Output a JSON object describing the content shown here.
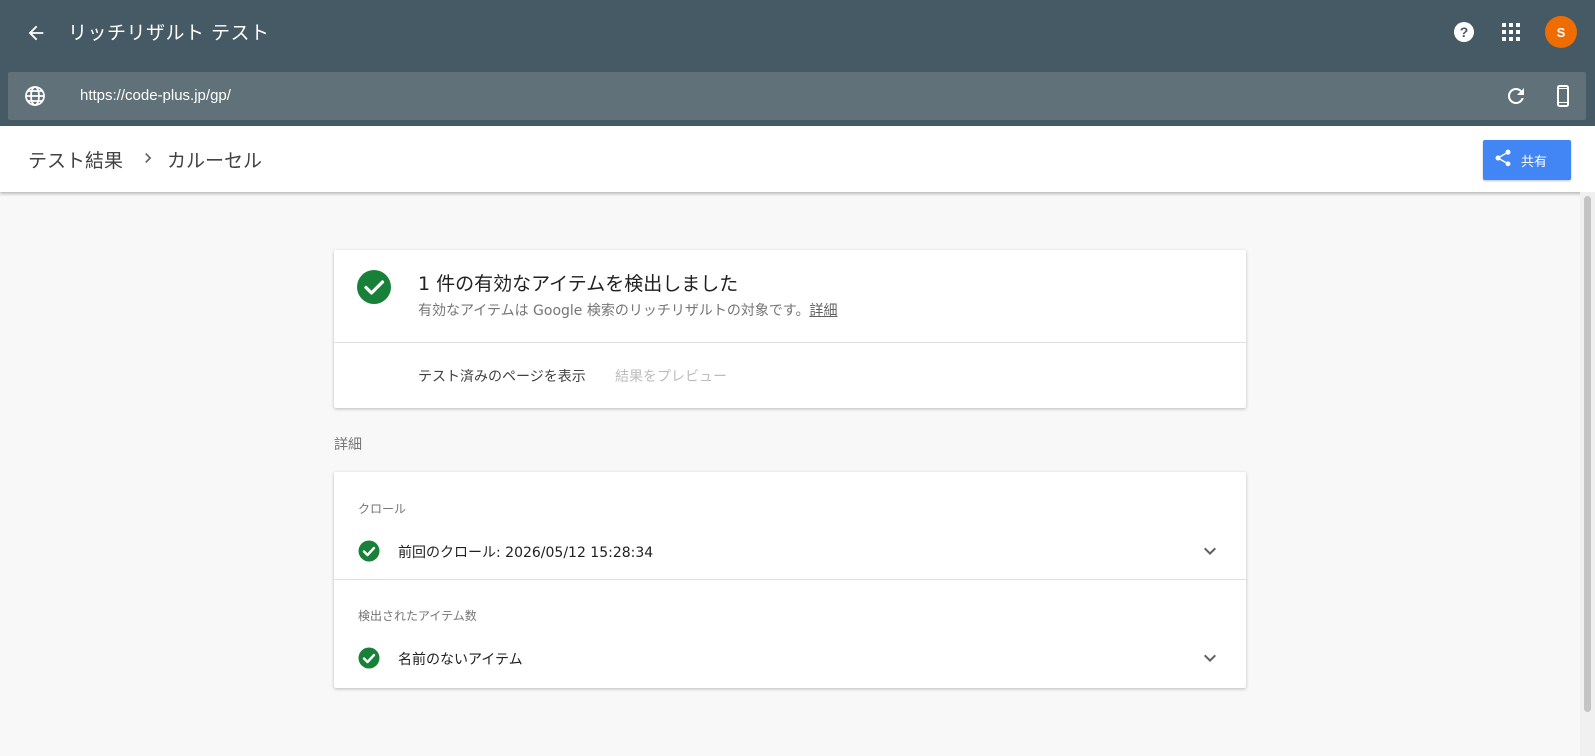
{
  "app": {
    "title": "リッチリザルト テスト",
    "avatar_letter": "S",
    "avatar_color": "#ef6c00",
    "header_color": "#455a64",
    "icons": [
      "back-arrow-icon",
      "help-icon",
      "apps-grid-icon"
    ]
  },
  "urlbar": {
    "url": "https://code-plus.jp/gp/",
    "icons": [
      "globe-icon",
      "reload-icon",
      "mobile-device-icon"
    ]
  },
  "breadcrumb": {
    "root": "テスト結果",
    "current": "カルーセル"
  },
  "share": {
    "label": "共有",
    "color": "#4285f4",
    "icon": "share-icon"
  },
  "summary": {
    "headline": "1 件の有効なアイテムを検出しました",
    "description": "有効なアイテムは Google 検索のリッチリザルトの対象です。",
    "details_link": "詳細",
    "status_color": "#188038",
    "actions": {
      "view_tested_page": "テスト済みのページを表示",
      "preview_result": "結果をプレビュー"
    }
  },
  "details": {
    "section_label": "詳細",
    "groups": [
      {
        "label": "クロール",
        "row_text": "前回のクロール: 2026/05/12 15:28:34"
      },
      {
        "label": "検出されたアイテム数",
        "row_text": "名前のないアイテム"
      }
    ]
  }
}
